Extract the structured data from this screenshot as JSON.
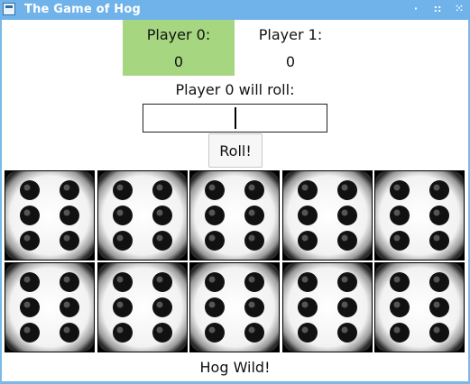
{
  "window": {
    "title": "The Game of Hog",
    "controls": [
      "·",
      "::",
      "⁙"
    ]
  },
  "players": [
    {
      "label": "Player 0:",
      "score": "0",
      "active": true
    },
    {
      "label": "Player 1:",
      "score": "0",
      "active": false
    }
  ],
  "roll_prompt": "Player 0 will roll:",
  "roll_input": {
    "value": "",
    "placeholder": ""
  },
  "roll_button_label": "Roll!",
  "dice": {
    "top_row": [
      6,
      6,
      6,
      6,
      6
    ],
    "bottom_row": [
      6,
      6,
      6,
      6,
      6
    ]
  },
  "status_message": "Hog Wild!",
  "colors": {
    "titlebar": "#6fb3ea",
    "active_player": "#a6d680",
    "die_face": "#ffffff",
    "pip": "#111111"
  }
}
